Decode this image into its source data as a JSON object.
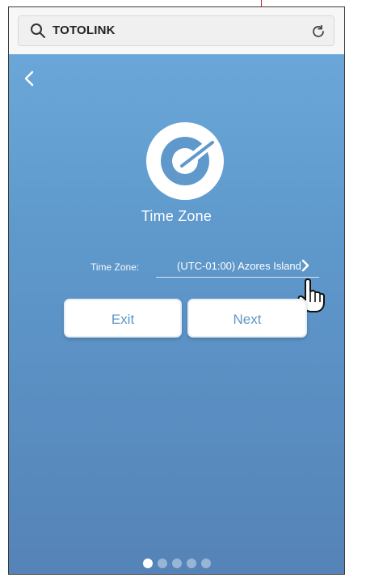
{
  "browser": {
    "search_text": "TOTOLINK",
    "icons": {
      "search": "search-icon",
      "refresh": "refresh-icon"
    }
  },
  "screen": {
    "title": "Time Zone",
    "back_icon": "back-icon",
    "logo_icon": "totolink-logo-icon",
    "time_zone_label": "Time Zone:",
    "time_zone_value": "(UTC-01:00) Azores Island",
    "buttons": {
      "exit": "Exit",
      "next": "Next"
    },
    "pager": {
      "total": 5,
      "active_index": 0
    }
  },
  "colors": {
    "background_top": "#6aa7d8",
    "background_bottom": "#5583b7",
    "button_text": "#5f96c6",
    "white": "#ffffff"
  }
}
